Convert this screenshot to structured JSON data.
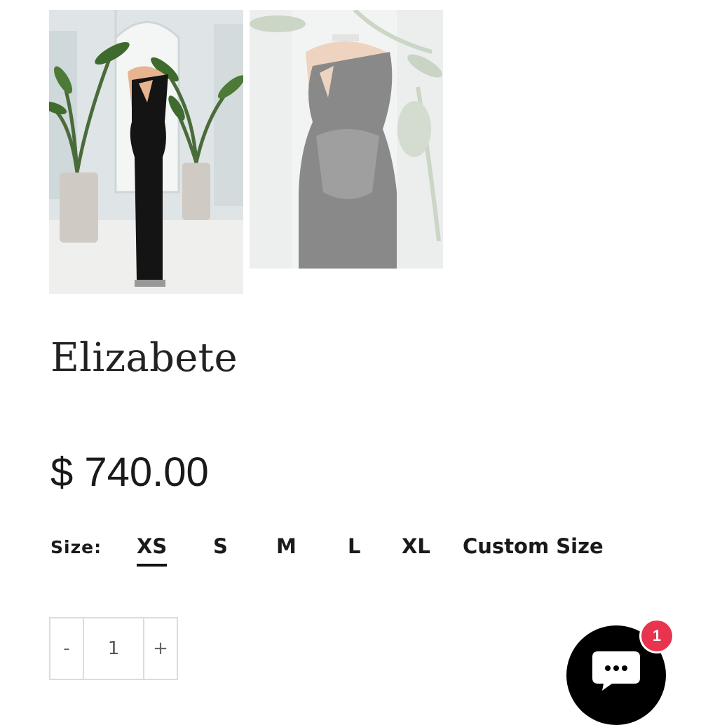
{
  "product": {
    "title": "Elizabete",
    "price": "$ 740.00",
    "images": [
      {
        "icon": "dress-full-length-photo"
      },
      {
        "icon": "dress-bodice-closeup-photo"
      }
    ]
  },
  "size": {
    "label": "Size:",
    "options": [
      "XS",
      "S",
      "M",
      "L",
      "XL",
      "Custom Size"
    ],
    "selected": "XS"
  },
  "quantity": {
    "decrement": "-",
    "value": "1",
    "increment": "+"
  },
  "chat": {
    "icon": "chat-bubble-icon",
    "badge_count": "1",
    "badge_color": "#e8344e"
  }
}
